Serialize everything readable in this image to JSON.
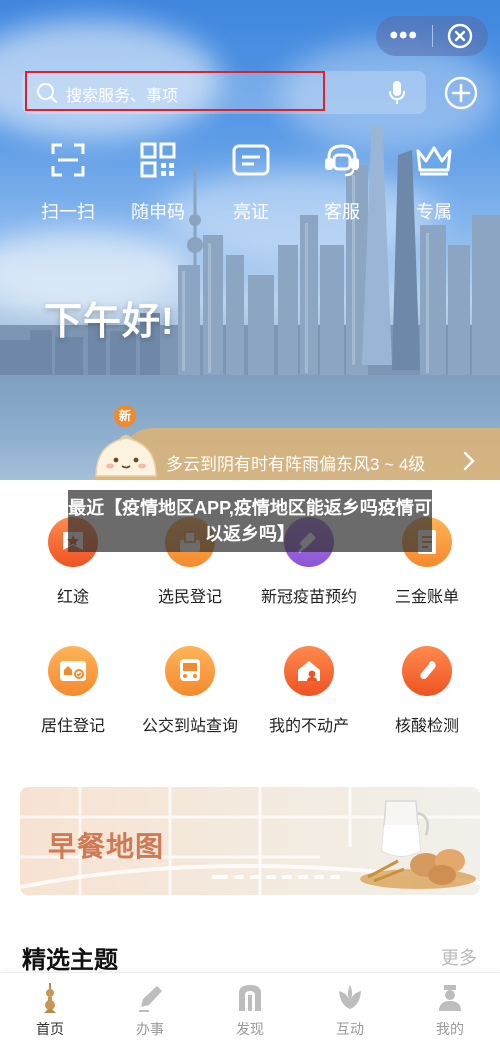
{
  "hero": {
    "search_placeholder": "搜索服务、事项",
    "greeting": "下午好!",
    "quick_actions": [
      {
        "label": "扫一扫",
        "icon": "scan-icon"
      },
      {
        "label": "随申码",
        "icon": "qr-code-icon"
      },
      {
        "label": "亮证",
        "icon": "id-card-icon"
      },
      {
        "label": "客服",
        "icon": "headset-icon"
      },
      {
        "label": "专属",
        "icon": "crown-icon"
      }
    ],
    "weather": {
      "badge": "新",
      "text": "多云到阴有时有阵雨偏东风3 ~ 4级"
    }
  },
  "overlay_caption": "最近【疫情地区APP,疫情地区能返乡吗疫情可以返乡吗】",
  "services": [
    {
      "label": "红途",
      "icon": "star-flag-icon"
    },
    {
      "label": "选民登记",
      "icon": "vote-icon"
    },
    {
      "label": "新冠疫苗预约",
      "icon": "syringe-icon"
    },
    {
      "label": "三金账单",
      "icon": "bill-icon"
    },
    {
      "label": "居住登记",
      "icon": "residence-card-icon"
    },
    {
      "label": "公交到站查询",
      "icon": "bus-icon"
    },
    {
      "label": "我的不动产",
      "icon": "house-icon"
    },
    {
      "label": "核酸检测",
      "icon": "test-tube-icon"
    }
  ],
  "banner": {
    "title": "早餐地图",
    "carousel_total": 8,
    "carousel_active": 1
  },
  "section": {
    "title": "精选主题",
    "more": "更多"
  },
  "tabbar": [
    {
      "label": "首页",
      "icon": "home-tower-icon",
      "active": true
    },
    {
      "label": "办事",
      "icon": "pen-icon",
      "active": false
    },
    {
      "label": "发现",
      "icon": "discover-icon",
      "active": false
    },
    {
      "label": "互动",
      "icon": "flower-icon",
      "active": false
    },
    {
      "label": "我的",
      "icon": "profile-icon",
      "active": false
    }
  ],
  "colors": {
    "accent_orange": "#f5892e",
    "weather_bar": "#d9b378",
    "search_outline": "#e0202a"
  }
}
